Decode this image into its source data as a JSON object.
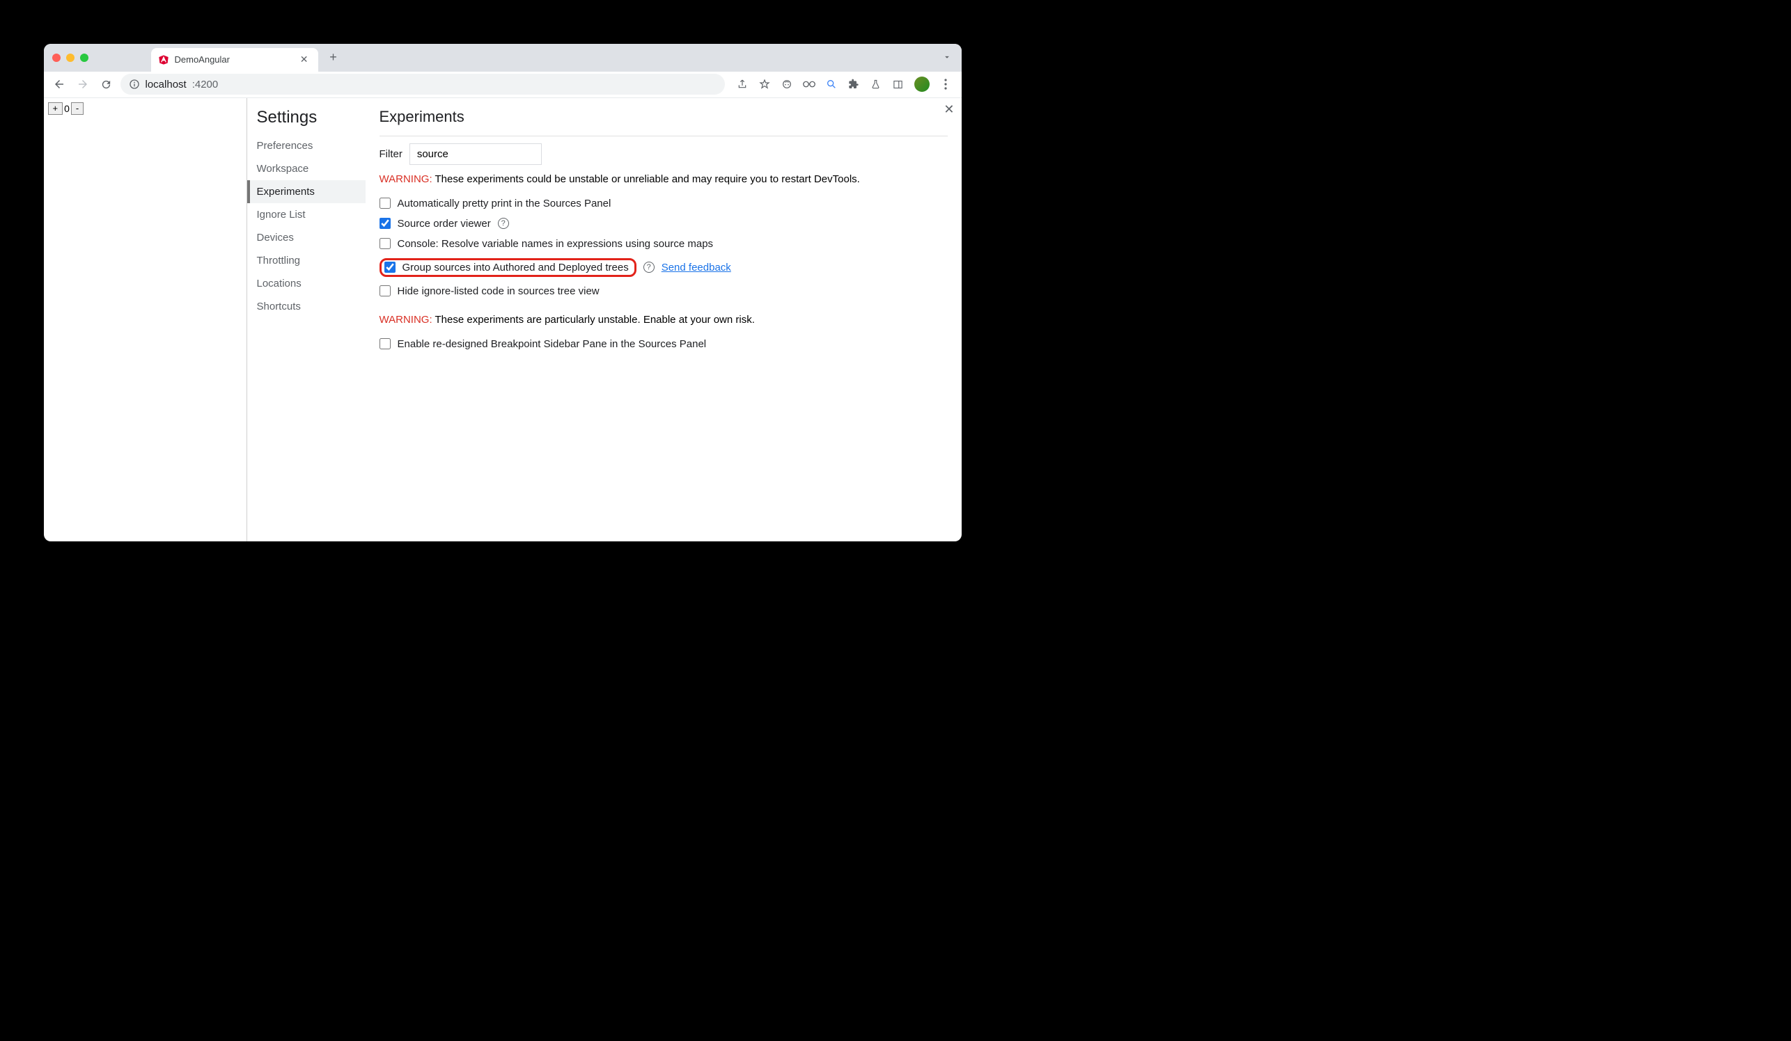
{
  "tab": {
    "title": "DemoAngular"
  },
  "url": {
    "host": "localhost",
    "port": ":4200"
  },
  "counter": {
    "plus": "+",
    "value": "0",
    "minus": "-"
  },
  "settings": {
    "title": "Settings",
    "nav": {
      "preferences": "Preferences",
      "workspace": "Workspace",
      "experiments": "Experiments",
      "ignore_list": "Ignore List",
      "devices": "Devices",
      "throttling": "Throttling",
      "locations": "Locations",
      "shortcuts": "Shortcuts"
    }
  },
  "panel": {
    "title": "Experiments",
    "filter_label": "Filter",
    "filter_value": "source",
    "warning1_label": "WARNING:",
    "warning1_text": " These experiments could be unstable or unreliable and may require you to restart DevTools.",
    "warning2_label": "WARNING:",
    "warning2_text": " These experiments are particularly unstable. Enable at your own risk.",
    "feedback": "Send feedback",
    "exp": {
      "pretty_print": "Automatically pretty print in the Sources Panel",
      "source_order": "Source order viewer",
      "console_resolve": "Console: Resolve variable names in expressions using source maps",
      "group_sources": "Group sources into Authored and Deployed trees",
      "hide_ignore": "Hide ignore-listed code in sources tree view",
      "breakpoint_sidebar": "Enable re-designed Breakpoint Sidebar Pane in the Sources Panel"
    }
  }
}
